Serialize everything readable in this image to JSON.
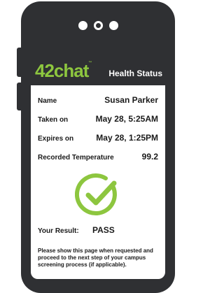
{
  "header": {
    "logo_text": "42chat",
    "logo_tm": "™",
    "title": "Health Status"
  },
  "fields": [
    {
      "label": "Name",
      "value": "Susan Parker"
    },
    {
      "label": "Taken on",
      "value": "May 28, 5:25AM"
    },
    {
      "label": "Expires on",
      "value": "May 28, 1:25PM"
    },
    {
      "label": "Recorded Temperature",
      "value": "99.2"
    }
  ],
  "result": {
    "label": "Your Result:",
    "value": "PASS",
    "icon": "check-circle-icon",
    "color": "#8dc63f"
  },
  "note": "Please show this page when requested and proceed to the next step of your campus screening process (if applicable).",
  "colors": {
    "frame": "#2f3033",
    "brand": "#8dc63f"
  }
}
